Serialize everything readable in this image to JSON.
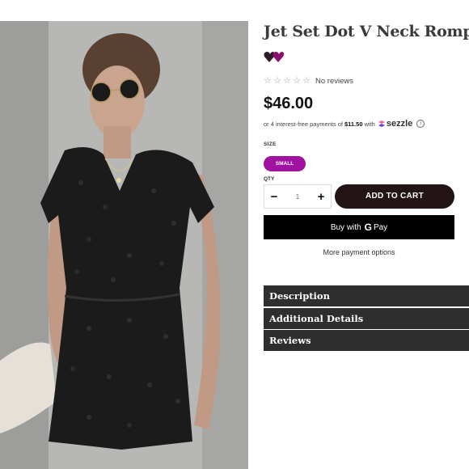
{
  "product": {
    "title": "Jet Set Dot V Neck Romper",
    "rating": {
      "stars": 0,
      "max_stars": 5,
      "reviews_text": "No reviews"
    },
    "price": "$46.00",
    "installment": {
      "prefix": "or 4 interest-free payments of",
      "amount": "$11.50",
      "suffix": "with",
      "provider": "sezzle"
    },
    "size": {
      "label": "SIZE",
      "selected": "SMALL"
    },
    "quantity": {
      "label": "QTY",
      "minus": "−",
      "value": "1",
      "plus": "+"
    },
    "add_to_cart": "ADD TO CART",
    "gpay": {
      "prefix": "Buy with",
      "g": "G",
      "pay": "Pay"
    },
    "more_payment": "More payment options"
  },
  "accordion": [
    {
      "label": "Description"
    },
    {
      "label": "Additional Details"
    },
    {
      "label": "Reviews"
    }
  ],
  "colors": {
    "size_selected": "#a012a0",
    "add_to_cart_bg": "#231515",
    "accordion_bg": "#2e2e2e",
    "brand_mark_left": "#2a1a2a",
    "brand_mark_right": "#8a1070"
  },
  "icons": {
    "brand_mark": "twin-hearts-icon",
    "star": "star-outline-icon",
    "sezzle": "sezzle-logo-icon",
    "info": "info-circle-icon"
  }
}
